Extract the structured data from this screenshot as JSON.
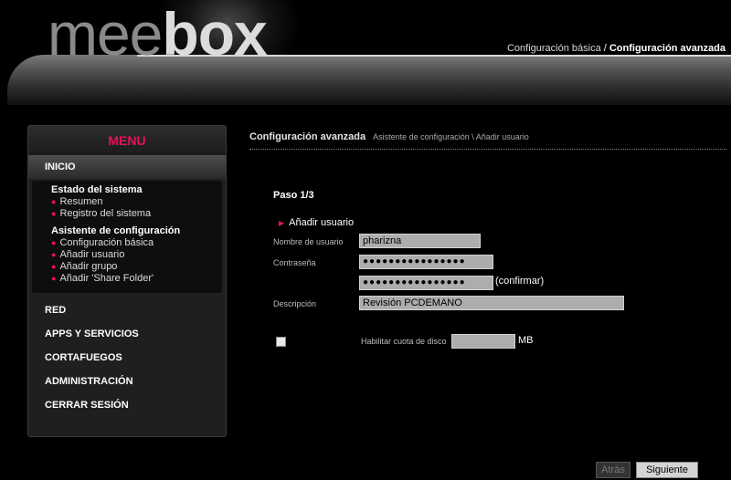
{
  "header": {
    "logo_part1": "mee",
    "logo_part2": "box",
    "link_basic": "Configuración básica",
    "separator": " / ",
    "link_advanced": "Configuración avanzada"
  },
  "sidebar": {
    "title": "MENU",
    "inicio": "INICIO",
    "groups": [
      {
        "label": "Estado del sistema",
        "items": [
          "Resumen",
          "Registro del sistema"
        ]
      },
      {
        "label": "Asistente de configuración",
        "items": [
          "Configuración básica",
          "Añadir usuario",
          "Añadir grupo",
          "Añadir 'Share Folder'"
        ]
      }
    ],
    "nav": [
      "RED",
      "APPS Y SERVICIOS",
      "CORTAFUEGOS",
      "ADMINISTRACIÓN",
      "CERRAR SESIÓN"
    ]
  },
  "main": {
    "breadcrumb_main": "Configuración avanzada",
    "breadcrumb_sub": "Asistente de configuración \\ Añadir usuario",
    "step": "Paso 1/3",
    "section": "Añadir usuario",
    "username_label": "Nombre de usuario",
    "username_value": "pharizna",
    "password_label": "Contraseña",
    "password_mask": "●●●●●●●●●●●●●●●●",
    "confirm_label": "(confirmar)",
    "description_label": "Descripción",
    "description_value": "Revisión PCDEMANO",
    "quota_label": "Habilitar cuota de disco",
    "quota_value": "",
    "quota_unit": "MB"
  },
  "buttons": {
    "back": "Atrás",
    "next": "Siguiente"
  },
  "colors": {
    "accent": "#e8105a",
    "background": "#000000",
    "field_bg": "#adadad"
  }
}
